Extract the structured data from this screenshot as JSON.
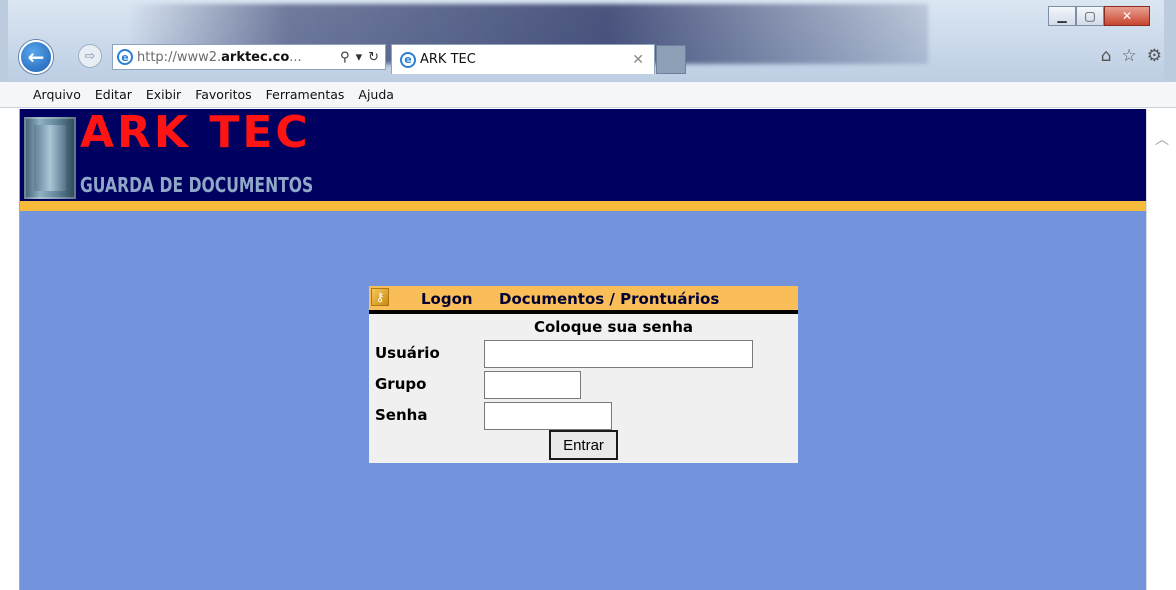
{
  "browser": {
    "address_url_prefix": "http://www2.",
    "address_url_domain": "arktec.co",
    "address_url_suffix": "...",
    "tab_title": "ARK TEC",
    "menu": [
      "Arquivo",
      "Editar",
      "Exibir",
      "Favoritos",
      "Ferramentas",
      "Ajuda"
    ]
  },
  "header": {
    "title": "ARK TEC",
    "subtitle": "GUARDA DE DOCUMENTOS"
  },
  "login": {
    "heading_logon": "Logon",
    "heading_docs": "Documentos / Prontuários",
    "subheading": "Coloque sua senha",
    "user_label": "Usuário",
    "group_label": "Grupo",
    "password_label": "Senha",
    "submit_label": "Entrar",
    "user_value": "",
    "group_value": "",
    "password_value": ""
  },
  "icons": {
    "back": "back-arrow-icon",
    "forward": "forward-arrow-icon",
    "ie": "internet-explorer-icon",
    "search": "search-icon",
    "refresh": "refresh-icon",
    "home": "home-icon",
    "favorites": "star-icon",
    "settings": "gear-icon",
    "key": "key-icon"
  },
  "colors": {
    "header_bg": "#000060",
    "brand_red": "#ff1414",
    "gold_bar": "#f7bb3c",
    "page_bg": "#7393dc"
  }
}
